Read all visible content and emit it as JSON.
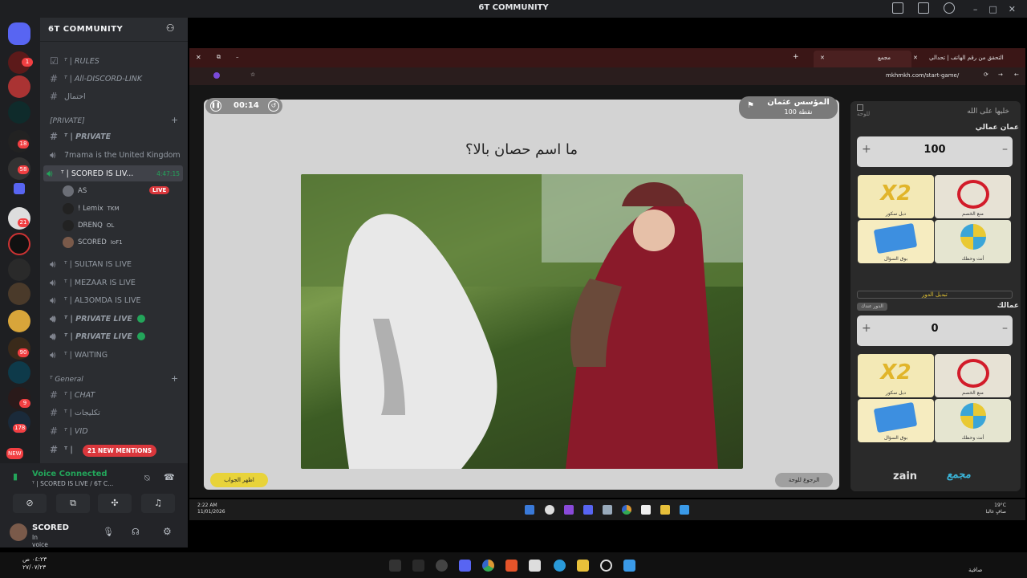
{
  "window": {
    "title": "6T COMMUNITY"
  },
  "server": {
    "name": "6T COMMUNITY"
  },
  "rail_badges": [
    "1",
    "18",
    "58",
    "21",
    "90",
    "9",
    "178",
    "NEW"
  ],
  "channels": [
    {
      "name": "ᵀ | RULES",
      "type": "rules"
    },
    {
      "name": "ᵀ | All-DISCORD-LINK",
      "type": "text"
    },
    {
      "name": "احتمال",
      "type": "text"
    }
  ],
  "category_private": "[PRIVATE]",
  "private_channels": [
    {
      "name": "ᵀ | PRIVATE",
      "type": "text"
    },
    {
      "name": "7mama is the United Kingdom",
      "type": "voice"
    }
  ],
  "active_voice": {
    "name": "ᵀ | SCORED IS LIV...",
    "time": "4:47:15"
  },
  "voice_users": [
    {
      "name": "AS",
      "live": "LIVE"
    },
    {
      "name": "! Lemix",
      "tag": "TKM"
    },
    {
      "name": "DRENQ",
      "tag": "OL"
    },
    {
      "name": "SCORED",
      "tag": "IoF1"
    }
  ],
  "voice_channels": [
    "ᵀ | SULTAN IS LIVE",
    "ᵀ | MEZAAR IS LIVE",
    "ᵀ | AL3OMDA IS LIVE",
    "ᵀ | PRIVATE LIVE",
    "ᵀ | PRIVATE LIVE",
    "ᵀ | WAITING"
  ],
  "category_general": "ᵀ General",
  "general_channels": [
    "ᵀ | CHAT",
    "ᵀ | تكليجات",
    "ᵀ | VID",
    "ᵀ |"
  ],
  "mentions": "21 NEW MENTIONS",
  "voice_panel": {
    "title": "Voice Connected",
    "subtitle": "ᵀ | SCORED IS LIVE / 6T C..."
  },
  "user": {
    "name": "SCORED",
    "status": "In voice"
  },
  "browser": {
    "tab1": "مجمع",
    "tab2": "التحقق من رقم الهاتف | تحدالي",
    "url": "mkhmkh.com/start-game/"
  },
  "game": {
    "timer": "00:14",
    "player_name": "المؤسس عثمان",
    "player_points": "100 نقطة",
    "question": "ما اسم حصان بالا؟",
    "answer_button": "اظهر الجواب",
    "back_button": "الرجوع للوحة"
  },
  "side": {
    "team_header": "خليها على الله",
    "board_link": "للوحة",
    "team1": {
      "name": "عمان عمالي",
      "score": "100"
    },
    "swap_label": "تبديل الدور",
    "team2": {
      "name": "عمالك",
      "score": "0",
      "turn": "الدور عندك"
    },
    "powerups": [
      "دبل سكور",
      "منع الخصم",
      "بوق السؤال",
      "أنت وحظك"
    ],
    "brand_left": "zain",
    "brand_right": "مجمع"
  },
  "remote_taskbar": {
    "time": "2:22 AM",
    "date": "11/01/2026",
    "weather": "19°C",
    "weather_note": "صافٍ غالبا"
  },
  "local_taskbar": {
    "time": "٠٤:٢٣ ص",
    "date": "٢٧/٠٧/٢٣",
    "weather_note": "صافية"
  }
}
